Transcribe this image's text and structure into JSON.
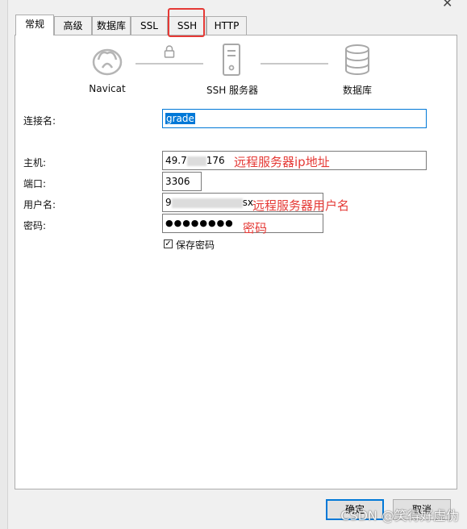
{
  "window": {
    "close_glyph": "✕"
  },
  "tabs": [
    {
      "label": "常规",
      "active": true
    },
    {
      "label": "高级",
      "active": false
    },
    {
      "label": "数据库",
      "active": false
    },
    {
      "label": "SSL",
      "active": false
    },
    {
      "label": "SSH",
      "active": false,
      "highlighted": true
    },
    {
      "label": "HTTP",
      "active": false
    }
  ],
  "diagram": {
    "navicat_label": "Navicat",
    "server_label": "SSH 服务器",
    "database_label": "数据库",
    "icons": [
      "navicat-logo-icon",
      "lock-icon",
      "server-icon",
      "database-icon"
    ]
  },
  "form": {
    "connection_name_label": "连接名:",
    "connection_name_value": "grade",
    "host_label": "主机:",
    "host_value_prefix": "49.7",
    "host_value_suffix": "176",
    "port_label": "端口:",
    "port_value": "3306",
    "username_label": "用户名:",
    "username_value_prefix": "9",
    "username_value_suffix": "sx",
    "password_label": "密码:",
    "password_value": "●●●●●●●●",
    "save_password_label": "保存密码",
    "save_password_checked": "✓"
  },
  "annotations": {
    "host_note": "远程服务器ip地址",
    "username_note": "远程服务器用户名",
    "password_note": "密码"
  },
  "buttons": {
    "ok": "确定",
    "cancel": "取消"
  },
  "watermark": "CSDN @笑得好虚伪",
  "colors": {
    "accent": "#0078d7",
    "annotation": "#e53935"
  }
}
